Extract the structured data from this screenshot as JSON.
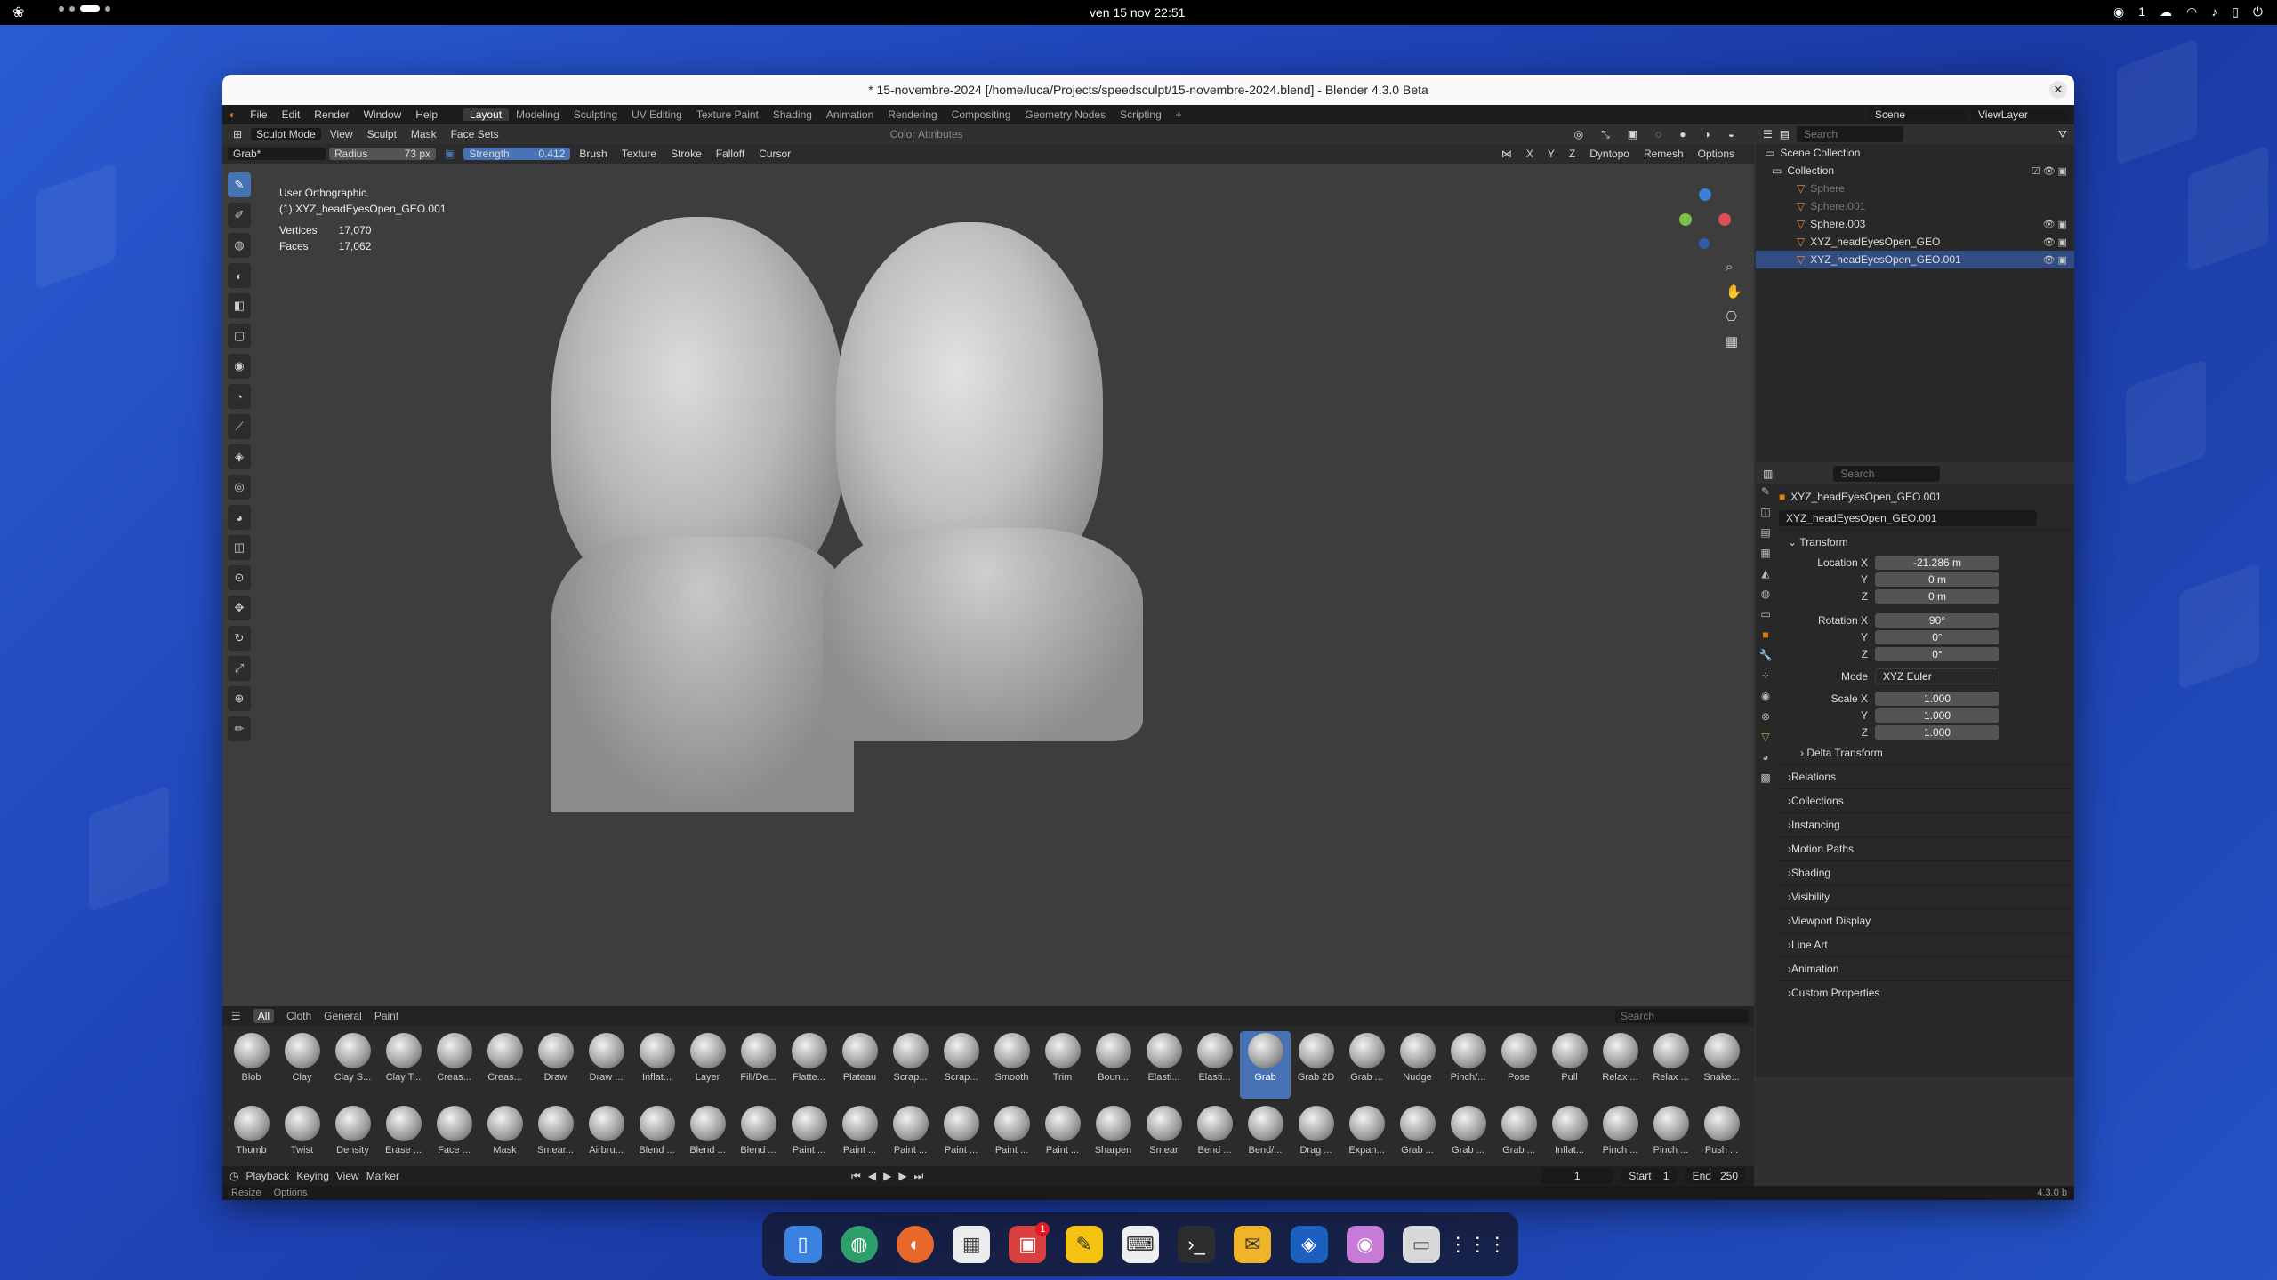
{
  "topbar": {
    "clock": "ven 15 nov  22:51",
    "workspace_num": "1"
  },
  "window": {
    "title": "* 15-novembre-2024 [/home/luca/Projects/speedsculpt/15-novembre-2024.blend] - Blender 4.3.0 Beta",
    "close": "✕"
  },
  "menu": {
    "items": [
      "File",
      "Edit",
      "Render",
      "Window",
      "Help"
    ],
    "workspaces": [
      "Layout",
      "Modeling",
      "Sculpting",
      "UV Editing",
      "Texture Paint",
      "Shading",
      "Animation",
      "Rendering",
      "Compositing",
      "Geometry Nodes",
      "Scripting"
    ],
    "add": "+",
    "scene": "Scene",
    "viewlayer": "ViewLayer"
  },
  "viewport_header": {
    "mode": "Sculpt Mode",
    "items": [
      "View",
      "Sculpt",
      "Mask",
      "Face Sets"
    ],
    "color_attr": "Color Attributes"
  },
  "tool_header": {
    "brush": "Grab*",
    "radius_label": "Radius",
    "radius_value": "73 px",
    "strength_label": "Strength",
    "strength_value": "0.412",
    "menus": [
      "Brush",
      "Texture",
      "Stroke",
      "Falloff",
      "Cursor"
    ],
    "axes": [
      "X",
      "Y",
      "Z"
    ],
    "dyntopo": "Dyntopo",
    "remesh": "Remesh",
    "options": "Options"
  },
  "viewport_info": {
    "view": "User Orthographic",
    "object": "(1) XYZ_headEyesOpen_GEO.001",
    "vertices_label": "Vertices",
    "vertices": "17,070",
    "faces_label": "Faces",
    "faces": "17,062"
  },
  "outliner": {
    "search_placeholder": "Search",
    "scene_collection": "Scene Collection",
    "collection": "Collection",
    "items": [
      "Sphere",
      "Sphere.001",
      "Sphere.003",
      "XYZ_headEyesOpen_GEO",
      "XYZ_headEyesOpen_GEO.001"
    ]
  },
  "properties": {
    "search_placeholder": "Search",
    "object_name": "XYZ_headEyesOpen_GEO.001",
    "object_field": "XYZ_headEyesOpen_GEO.001",
    "transform": "Transform",
    "location_x_label": "Location X",
    "location_x": "-21.286 m",
    "y_label": "Y",
    "z_label": "Z",
    "location_y": "0 m",
    "location_z": "0 m",
    "rotation_x_label": "Rotation X",
    "rotation_x": "90°",
    "rotation_y": "0°",
    "rotation_z": "0°",
    "mode_label": "Mode",
    "mode": "XYZ Euler",
    "scale_x_label": "Scale X",
    "scale_x": "1.000",
    "scale_y": "1.000",
    "scale_z": "1.000",
    "delta": "Delta Transform",
    "panels": [
      "Relations",
      "Collections",
      "Instancing",
      "Motion Paths",
      "Shading",
      "Visibility",
      "Viewport Display",
      "Line Art",
      "Animation",
      "Custom Properties"
    ]
  },
  "brushes": {
    "tabs": [
      "All",
      "Cloth",
      "General",
      "Paint"
    ],
    "search_placeholder": "Search",
    "row1": [
      "Blob",
      "Clay",
      "Clay S...",
      "Clay T...",
      "Creas...",
      "Creas...",
      "Draw",
      "Draw ...",
      "Inflat...",
      "Layer",
      "Fill/De...",
      "Flatte...",
      "Plateau",
      "Scrap...",
      "Scrap...",
      "Smooth",
      "Trim",
      "Boun...",
      "Elasti...",
      "Elasti...",
      "Grab",
      "Grab 2D",
      "Grab ...",
      "Nudge",
      "Pinch/...",
      "Pose",
      "Pull",
      "Relax ...",
      "Relax ...",
      "Snake..."
    ],
    "row2": [
      "Thumb",
      "Twist",
      "Density",
      "Erase ...",
      "Face ...",
      "Mask",
      "Smear...",
      "Airbru...",
      "Blend ...",
      "Blend ...",
      "Blend ...",
      "Paint ...",
      "Paint ...",
      "Paint ...",
      "Paint ...",
      "Paint ...",
      "Paint ...",
      "Sharpen",
      "Smear",
      "Bend ...",
      "Bend/...",
      "Drag ...",
      "Expan...",
      "Grab ...",
      "Grab ...",
      "Grab ...",
      "Inflat...",
      "Pinch ...",
      "Pinch ...",
      "Push ..."
    ],
    "selected": "Grab"
  },
  "timeline": {
    "playback": "Playback",
    "keying": "Keying",
    "view": "View",
    "marker": "Marker",
    "current_frame": "1",
    "start_label": "Start",
    "start": "1",
    "end_label": "End",
    "end": "250"
  },
  "status": {
    "resize": "Resize",
    "options": "Options",
    "version": "4.3.0 b"
  },
  "dock": {
    "badge": "1"
  }
}
